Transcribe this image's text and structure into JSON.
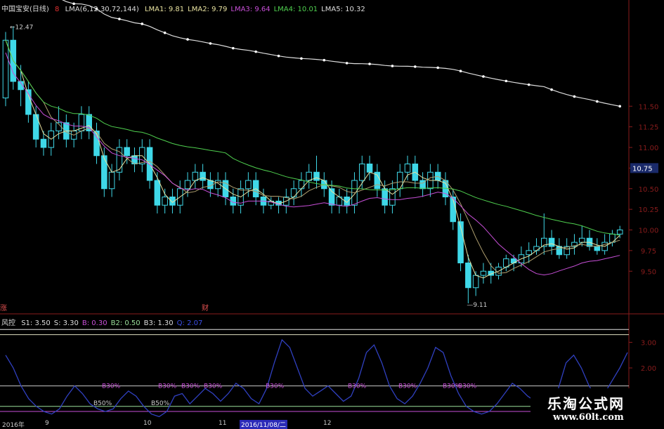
{
  "header": {
    "stock": "中国宝安(日线)",
    "marker": "8",
    "lma_params": "LMA(6,12,30,72,144)",
    "lma_values": [
      {
        "label": "LMA1: 9.81",
        "color": "#e8e2a0"
      },
      {
        "label": "LMA2: 9.79",
        "color": "#e8e2a0"
      },
      {
        "label": "LMA3: 9.64",
        "color": "#c84fd8"
      },
      {
        "label": "LMA4: 10.01",
        "color": "#4fd04f"
      },
      {
        "label": "LMA5: 10.32",
        "color": "#dddddd"
      }
    ]
  },
  "indicator_header": {
    "name": "风控",
    "items": [
      {
        "label": "S1: 3.50",
        "color": "#dddddd"
      },
      {
        "label": "S: 3.30",
        "color": "#dddddd"
      },
      {
        "label": "B: 0.30",
        "color": "#c84fd8"
      },
      {
        "label": "B2: 0.50",
        "color": "#9adf9a"
      },
      {
        "label": "B3: 1.30",
        "color": "#dddddd"
      },
      {
        "label": "Q: 2.07",
        "color": "#3b4fe8"
      }
    ]
  },
  "price_annotations": {
    "high": "12.47",
    "low": "9.11",
    "current": "10.75"
  },
  "event_markers": [
    "涨",
    "财"
  ],
  "x_dates": [
    "2016年",
    "9",
    "10",
    "11",
    "2016/11/08/二",
    "12"
  ],
  "watermark": {
    "title": "乐淘公式网",
    "url": "www.60lt.com"
  },
  "band_labels": {
    "b30": "B30%",
    "b50": "B50%",
    "b30_positions": [
      145,
      225,
      258,
      290,
      378,
      495,
      567,
      630,
      652
    ],
    "b50_positions": [
      133,
      215
    ]
  },
  "colors": {
    "up": "#3fd8e8",
    "down": "#3fd8e8",
    "lma1": "#e8e2a0",
    "lma2": "#b0a070",
    "lma3": "#c84fd8",
    "lma4": "#4fd04f",
    "lma5": "#dddddd",
    "q": "#3040c0"
  },
  "chart_data": [
    {
      "type": "candlestick",
      "title": "中国宝安(日线)",
      "y_ticks": [
        "11.50",
        "11.25",
        "11.00",
        "10.75",
        "10.50",
        "10.25",
        "10.00",
        "9.75",
        "9.50"
      ],
      "ylim": [
        9.0,
        12.6
      ],
      "high": 12.47,
      "low": 9.11,
      "candles": [
        [
          11.6,
          12.3,
          11.5,
          12.4
        ],
        [
          12.3,
          11.8,
          11.7,
          12.47
        ],
        [
          11.8,
          11.7,
          11.5,
          12.0
        ],
        [
          11.7,
          11.4,
          11.3,
          11.8
        ],
        [
          11.4,
          11.1,
          11.0,
          11.5
        ],
        [
          11.1,
          11.0,
          10.9,
          11.2
        ],
        [
          11.0,
          11.2,
          10.9,
          11.3
        ],
        [
          11.2,
          11.3,
          11.1,
          11.5
        ],
        [
          11.3,
          11.1,
          11.0,
          11.4
        ],
        [
          11.1,
          11.2,
          11.0,
          11.3
        ],
        [
          11.2,
          11.4,
          11.1,
          11.5
        ],
        [
          11.4,
          11.2,
          11.1,
          11.5
        ],
        [
          11.2,
          10.9,
          10.8,
          11.3
        ],
        [
          10.9,
          10.5,
          10.4,
          11.0
        ],
        [
          10.5,
          10.7,
          10.4,
          10.8
        ],
        [
          10.7,
          11.0,
          10.6,
          11.1
        ],
        [
          11.0,
          10.9,
          10.8,
          11.1
        ],
        [
          10.9,
          10.8,
          10.7,
          11.0
        ],
        [
          10.8,
          11.0,
          10.7,
          11.1
        ],
        [
          11.0,
          10.6,
          10.5,
          11.1
        ],
        [
          10.6,
          10.3,
          10.2,
          10.7
        ],
        [
          10.3,
          10.4,
          10.2,
          10.5
        ],
        [
          10.4,
          10.3,
          10.2,
          10.5
        ],
        [
          10.3,
          10.5,
          10.2,
          10.6
        ],
        [
          10.5,
          10.6,
          10.4,
          10.7
        ],
        [
          10.6,
          10.7,
          10.5,
          10.8
        ],
        [
          10.7,
          10.6,
          10.5,
          10.8
        ],
        [
          10.6,
          10.5,
          10.4,
          10.7
        ],
        [
          10.5,
          10.6,
          10.4,
          10.7
        ],
        [
          10.6,
          10.4,
          10.3,
          10.7
        ],
        [
          10.4,
          10.3,
          10.2,
          10.5
        ],
        [
          10.3,
          10.5,
          10.2,
          10.6
        ],
        [
          10.5,
          10.6,
          10.4,
          10.7
        ],
        [
          10.6,
          10.4,
          10.3,
          10.7
        ],
        [
          10.4,
          10.3,
          10.2,
          10.5
        ],
        [
          10.3,
          10.35,
          10.25,
          10.4
        ],
        [
          10.35,
          10.3,
          10.2,
          10.4
        ],
        [
          10.3,
          10.4,
          10.2,
          10.5
        ],
        [
          10.4,
          10.5,
          10.3,
          10.6
        ],
        [
          10.5,
          10.6,
          10.4,
          10.7
        ],
        [
          10.6,
          10.7,
          10.5,
          10.8
        ],
        [
          10.7,
          10.6,
          10.5,
          10.9
        ],
        [
          10.6,
          10.5,
          10.4,
          10.7
        ],
        [
          10.5,
          10.3,
          10.2,
          10.6
        ],
        [
          10.3,
          10.4,
          10.2,
          10.5
        ],
        [
          10.4,
          10.3,
          10.2,
          10.5
        ],
        [
          10.3,
          10.6,
          10.2,
          10.7
        ],
        [
          10.6,
          10.8,
          10.5,
          10.9
        ],
        [
          10.8,
          10.7,
          10.6,
          10.9
        ],
        [
          10.7,
          10.5,
          10.4,
          10.8
        ],
        [
          10.5,
          10.3,
          10.2,
          10.6
        ],
        [
          10.3,
          10.5,
          10.2,
          10.6
        ],
        [
          10.5,
          10.7,
          10.4,
          10.8
        ],
        [
          10.7,
          10.8,
          10.6,
          10.9
        ],
        [
          10.8,
          10.6,
          10.5,
          10.9
        ],
        [
          10.6,
          10.5,
          10.4,
          10.7
        ],
        [
          10.5,
          10.7,
          10.4,
          10.8
        ],
        [
          10.7,
          10.6,
          10.5,
          10.8
        ],
        [
          10.6,
          10.4,
          10.3,
          10.7
        ],
        [
          10.4,
          10.1,
          10.0,
          10.5
        ],
        [
          10.1,
          9.6,
          9.5,
          10.2
        ],
        [
          9.6,
          9.3,
          9.11,
          9.7
        ],
        [
          9.3,
          9.45,
          9.2,
          9.5
        ],
        [
          9.45,
          9.5,
          9.35,
          9.6
        ],
        [
          9.5,
          9.45,
          9.35,
          9.6
        ],
        [
          9.45,
          9.55,
          9.4,
          9.6
        ],
        [
          9.55,
          9.65,
          9.5,
          9.7
        ],
        [
          9.65,
          9.6,
          9.5,
          9.7
        ],
        [
          9.6,
          9.7,
          9.55,
          9.8
        ],
        [
          9.7,
          9.75,
          9.6,
          9.85
        ],
        [
          9.75,
          9.8,
          9.7,
          9.9
        ],
        [
          9.8,
          9.9,
          9.7,
          10.2
        ],
        [
          9.9,
          9.8,
          9.7,
          10.0
        ],
        [
          9.8,
          9.7,
          9.65,
          9.9
        ],
        [
          9.7,
          9.8,
          9.65,
          9.9
        ],
        [
          9.8,
          9.85,
          9.7,
          9.95
        ],
        [
          9.85,
          9.9,
          9.8,
          10.05
        ],
        [
          9.9,
          9.8,
          9.75,
          10.0
        ],
        [
          9.8,
          9.75,
          9.7,
          9.9
        ],
        [
          9.75,
          9.85,
          9.7,
          9.95
        ],
        [
          9.85,
          9.95,
          9.8,
          10.0
        ],
        [
          9.95,
          10.0,
          9.9,
          10.05
        ]
      ]
    },
    {
      "type": "line",
      "title": "风控",
      "y_ticks": [
        "3.00",
        "2.00"
      ],
      "ylim": [
        0,
        3.7
      ],
      "levels": {
        "S1": 3.5,
        "S": 3.3,
        "B": 0.3,
        "B2": 0.5,
        "B3": 1.3
      },
      "series": [
        {
          "name": "Q",
          "values": [
            2.5,
            2.0,
            1.3,
            0.8,
            0.5,
            0.3,
            0.2,
            0.4,
            0.9,
            1.3,
            1.0,
            0.6,
            0.4,
            0.3,
            0.4,
            0.8,
            1.1,
            0.9,
            0.5,
            0.2,
            0.1,
            0.3,
            0.9,
            1.0,
            0.6,
            0.9,
            1.2,
            1.0,
            0.7,
            1.0,
            1.4,
            1.2,
            0.8,
            0.6,
            1.2,
            2.2,
            3.1,
            2.8,
            2.0,
            1.2,
            0.9,
            1.1,
            1.3,
            1.0,
            0.7,
            0.9,
            1.6,
            2.6,
            2.9,
            2.2,
            1.3,
            0.8,
            0.6,
            0.9,
            1.4,
            2.0,
            2.8,
            2.6,
            1.7,
            1.0,
            0.5,
            0.3,
            0.2,
            0.3,
            0.6,
            1.0,
            1.4,
            1.2,
            0.9,
            0.7,
            0.5,
            0.6,
            1.2,
            2.2,
            2.5,
            2.0,
            1.3,
            0.8,
            1.0,
            1.5,
            2.0,
            2.6
          ]
        }
      ]
    }
  ]
}
